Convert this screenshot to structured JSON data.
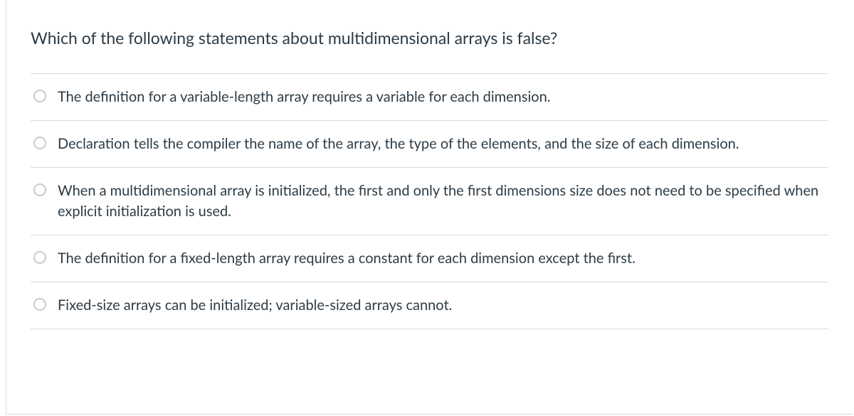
{
  "question": "Which of the following statements about multidimensional arrays is false?",
  "options": [
    {
      "label": "The definition for a variable-length array requires a variable for each dimension."
    },
    {
      "label": "Declaration tells the compiler the name of the array, the type of the elements, and the size of each dimension."
    },
    {
      "label": "When a multidimensional array is initialized, the first and only the first dimensions size does not need to be specified when explicit initialization is used."
    },
    {
      "label": "The definition for a fixed-length array requires a constant for each dimension except the first."
    },
    {
      "label": "Fixed-size arrays can be initialized; variable-sized arrays cannot."
    }
  ]
}
